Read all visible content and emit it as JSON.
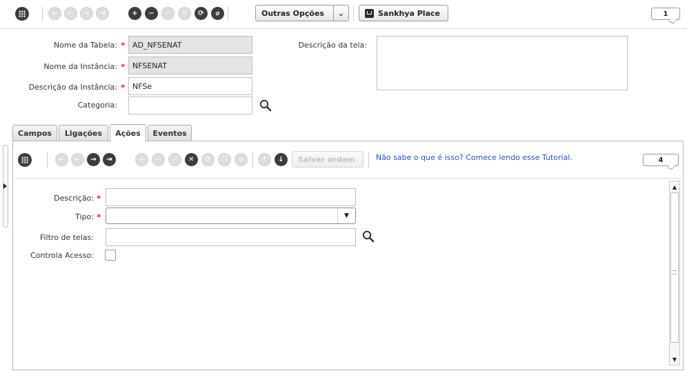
{
  "toolbar": {
    "outras_opcoes": "Outras Opções",
    "dropdown_glyph": "⌄",
    "sankhya_place": "Sankhya Place",
    "counter": "1"
  },
  "form": {
    "nome_tabela": {
      "label": "Nome da Tabela:",
      "value": "AD_NFSENAT"
    },
    "nome_instancia": {
      "label": "Nome da Instância:",
      "value": "NFSENAT"
    },
    "descricao_instancia": {
      "label": "Descrição da Instância:",
      "value": "NFSe"
    },
    "categoria": {
      "label": "Categoria:",
      "value": ""
    },
    "descricao_tela": {
      "label": "Descrição da tela:",
      "value": ""
    },
    "required_mark": "*"
  },
  "tabs": [
    {
      "label": "Campos"
    },
    {
      "label": "Ligações"
    },
    {
      "label": "Ações"
    },
    {
      "label": "Eventos"
    }
  ],
  "actions_toolbar": {
    "salvar_ordem": "Salvar ordem",
    "tutorial_link": "Não sabe o que é isso? Comece lendo esse Tutorial.",
    "counter": "4"
  },
  "detail": {
    "descricao": {
      "label": "Descrição:",
      "value": ""
    },
    "tipo": {
      "label": "Tipo:",
      "value": ""
    },
    "filtro_telas": {
      "label": "Filtro de telas:",
      "value": ""
    },
    "controla_acesso": {
      "label": "Controla Acesso:",
      "checked": false
    }
  },
  "colors": {
    "accent_link": "#2a4fb5",
    "required": "#e0303a",
    "icon_dark": "#3d3d3d"
  }
}
